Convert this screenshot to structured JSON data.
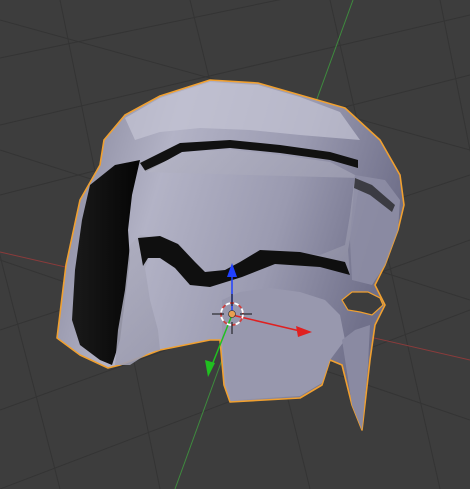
{
  "viewport": {
    "background": "#3d3d3d",
    "grid_color": "#343434",
    "x_axis_color": "#8a3b3b",
    "y_axis_color": "#3e8a3e"
  },
  "object": {
    "type": "helmet-mesh",
    "selected": true,
    "outline_color": "#f0a030",
    "mesh_color": "#a3a3b8",
    "visor_color": "#0b0b0b"
  },
  "gizmo": {
    "x_color": "#e02020",
    "y_color": "#20c020",
    "z_color": "#2040ff",
    "center_color": "#e8a050"
  },
  "cursor": {
    "ring_colors": [
      "#ffffff",
      "#d04040"
    ]
  }
}
